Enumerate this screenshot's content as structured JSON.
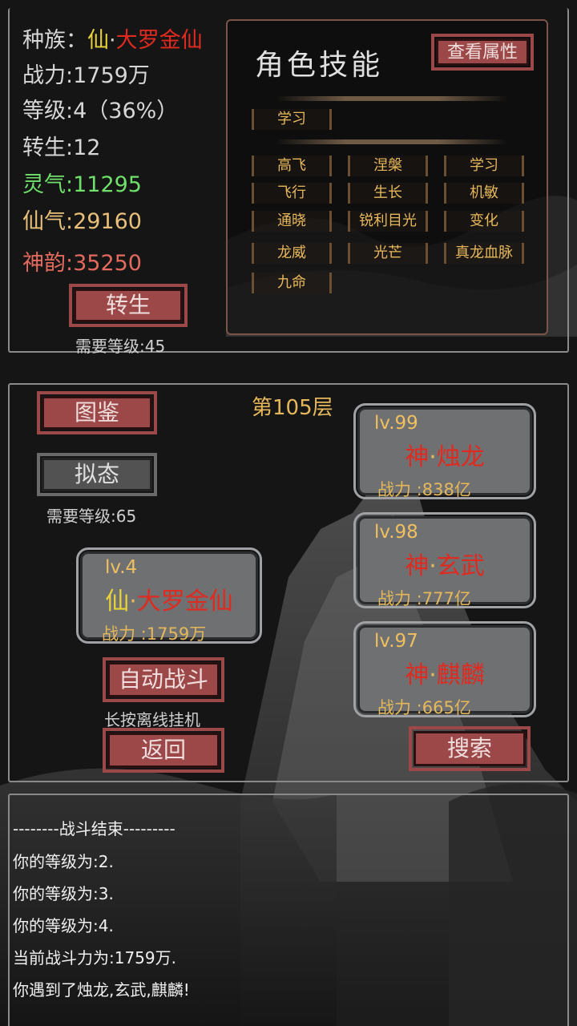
{
  "stats": {
    "race_label": "种族",
    "race_prefix": "仙",
    "race_name": "大罗金仙",
    "power_label": "战力",
    "power_value": ":1759万",
    "level_label": "等级",
    "level_value": ":4（36%）",
    "rebirth_label": "转生",
    "rebirth_value": ":12",
    "lingqi_label": "灵气",
    "lingqi_value": ":11295",
    "xianqi_label": "仙气",
    "xianqi_value": ":29160",
    "shenyun_label": "神韵",
    "shenyun_value": ":35250",
    "rebirth_button": "转生",
    "rebirth_requirement": "需要等级:45"
  },
  "skills": {
    "title": "角色技能",
    "view_attributes_button": "查看属性",
    "learn_chip": "学习",
    "rows": [
      [
        "高飞",
        "涅槃",
        "学习"
      ],
      [
        "飞行",
        "生长",
        "机敏"
      ],
      [
        "通晓",
        "锐利目光",
        "变化"
      ],
      [
        "龙威",
        "光芒",
        "真龙血脉"
      ],
      [
        "九命"
      ]
    ]
  },
  "battle": {
    "floor": "第105层",
    "codex_button": "图鉴",
    "mimic_button": "拟态",
    "mimic_requirement": "需要等级:65",
    "auto_battle_button": "自动战斗",
    "auto_battle_hint": "长按离线挂机",
    "back_button": "返回",
    "search_button": "搜索",
    "player": {
      "level": "lv.4",
      "prefix": "仙",
      "name": "大罗金仙",
      "power": "战力 :1759万"
    },
    "enemies": [
      {
        "level": "lv.99",
        "prefix": "神",
        "name": "烛龙",
        "power": "战力 :838亿"
      },
      {
        "level": "lv.98",
        "prefix": "神",
        "name": "玄武",
        "power": "战力 :777亿"
      },
      {
        "level": "lv.97",
        "prefix": "神",
        "name": "麒麟",
        "power": "战力 :665亿"
      }
    ]
  },
  "log": [
    "--------战斗结束---------",
    "你的等级为:2.",
    "你的等级为:3.",
    "你的等级为:4.",
    "当前战斗力为:1759万.",
    "你遇到了烛龙,玄武,麒麟!"
  ],
  "colors": {
    "accent_red": "#9c4848",
    "frame_grey": "#8a8a8a",
    "gold_text": "#e6b85a"
  }
}
